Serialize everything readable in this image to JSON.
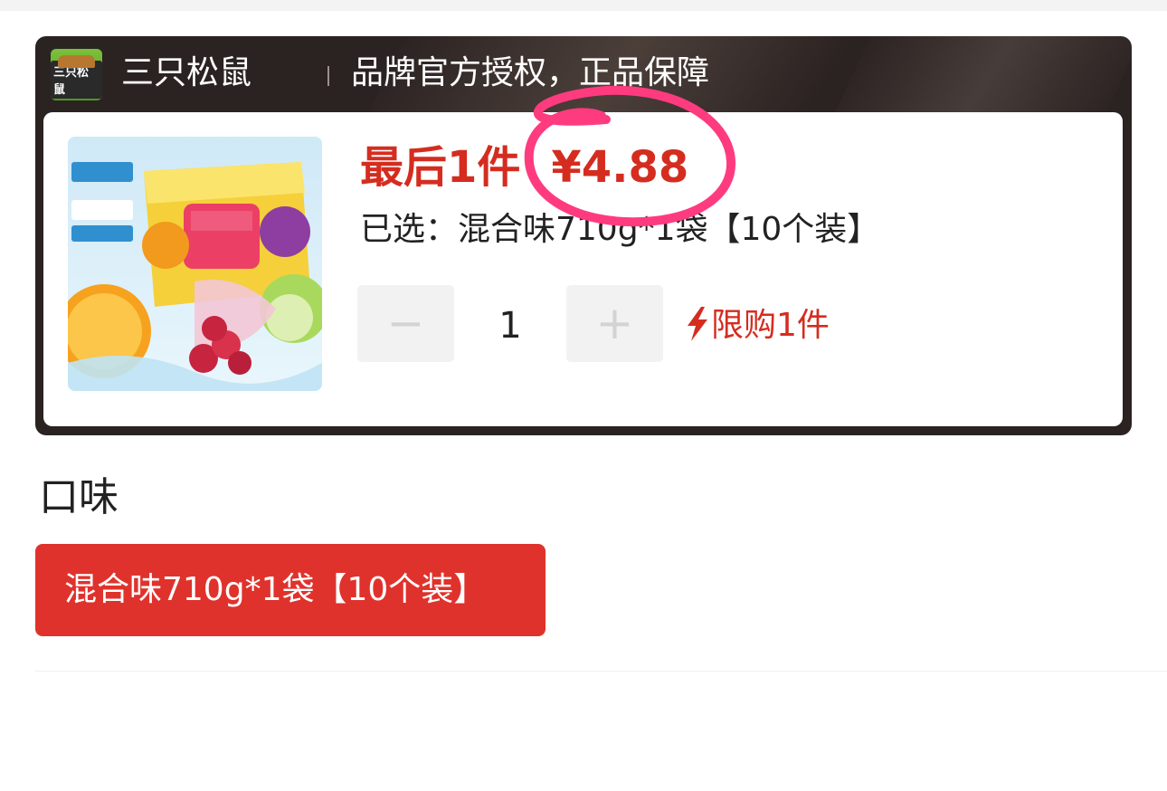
{
  "brand": {
    "logo_text": "三只松鼠",
    "name": "三只松鼠",
    "slogan": "品牌官方授权，正品保障"
  },
  "product": {
    "stock_label": "最后1件",
    "price": "¥4.88",
    "selected": "已选：混合味710g*1袋【10个装】",
    "quantity": "1",
    "minus_label": "−",
    "plus_label": "+",
    "limit_label": "限购1件"
  },
  "flavor": {
    "title": "口味",
    "options": [
      "混合味710g*1袋【10个装】"
    ],
    "selected_index": 0
  },
  "colors": {
    "accent": "#d42d20",
    "annotation": "#ff3b7f",
    "header_bg": "#2b2322"
  },
  "icons": {
    "logo": "brand-logo-icon",
    "limit": "lightning-bolt-icon"
  }
}
